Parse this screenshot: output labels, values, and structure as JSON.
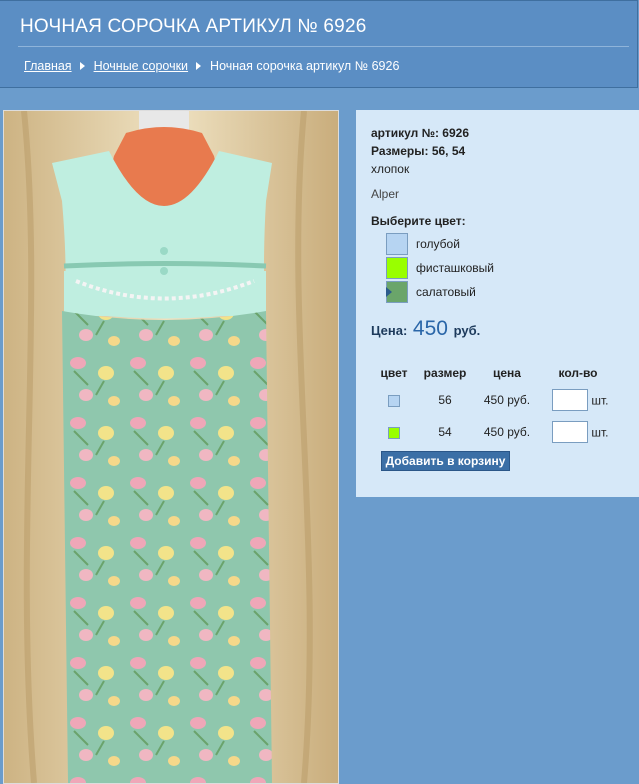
{
  "header": {
    "title": "НОЧНАЯ СОРОЧКА АРТИКУЛ № 6926",
    "breadcrumb": [
      "Главная",
      "Ночные сорочки",
      "Ночная сорочка артикул № 6926"
    ]
  },
  "product": {
    "article_label": "артикул №:",
    "article_value": "6926",
    "sizes_label": "Размеры:",
    "sizes_value": "56, 54",
    "material": "хлопок",
    "brand": "Alper",
    "choose_color_label": "Выберите цвет:",
    "colors": [
      {
        "name": "голубой",
        "hex": "#b6d4f2"
      },
      {
        "name": "фисташковый",
        "hex": "#99ff00"
      },
      {
        "name": "салатовый",
        "hex": "#6aa56a"
      }
    ],
    "selected_color": "салатовый",
    "price_label": "Цена:",
    "price_value": "450",
    "price_currency": "руб."
  },
  "options_table": {
    "headers": [
      "цвет",
      "размер",
      "цена",
      "кол-во"
    ],
    "rows": [
      {
        "color_hex": "#b6d4f2",
        "size": "56",
        "price": "450 руб.",
        "unit": "шт."
      },
      {
        "color_hex": "#99ff00",
        "size": "54",
        "price": "450 руб.",
        "unit": "шт."
      }
    ]
  },
  "add_to_cart_label": "Добавить в корзину",
  "colors": {
    "page_bg": "#6b9ccc",
    "header_bg": "#5b8ec4",
    "panel_bg": "#d6e8f8",
    "button_bg": "#3b6fa6"
  }
}
